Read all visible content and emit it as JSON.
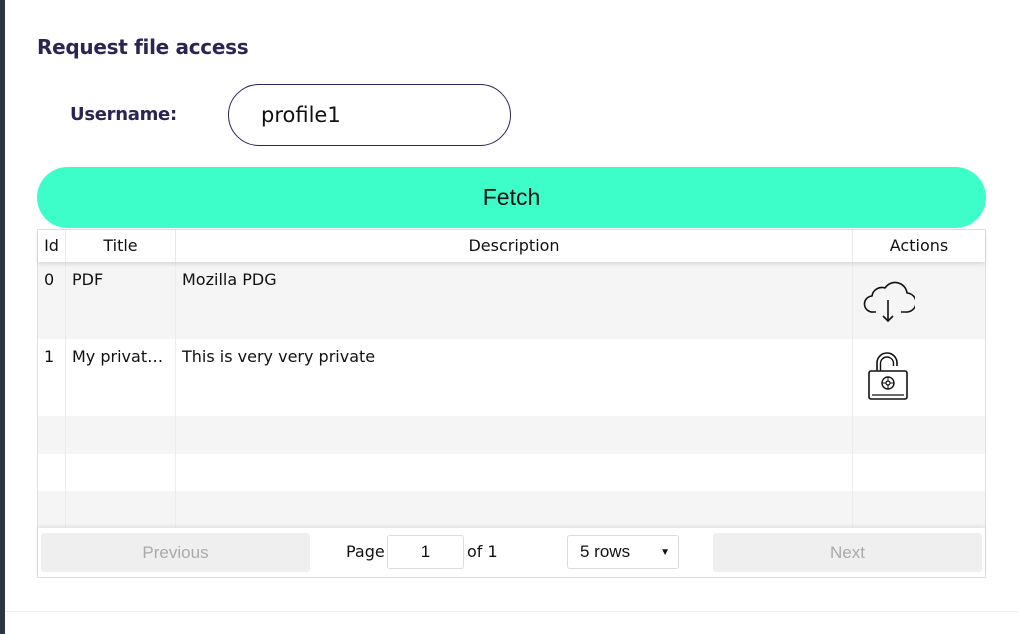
{
  "page": {
    "title": "Request file access"
  },
  "form": {
    "username_label": "Username:",
    "username_value": "profile1",
    "fetch_label": "Fetch"
  },
  "table": {
    "headers": {
      "id": "Id",
      "title": "Title",
      "description": "Description",
      "actions": "Actions"
    },
    "rows": [
      {
        "id": "0",
        "title": "PDF",
        "description": "Mozilla PDG",
        "action_icon": "cloud-download-icon"
      },
      {
        "id": "1",
        "title": "My private...",
        "description": "This is very very private",
        "action_icon": "unlock-padlock-icon"
      }
    ]
  },
  "pagination": {
    "previous_label": "Previous",
    "page_label": "Page",
    "current_page": "1",
    "of_label": "of 1",
    "rows_option": "5 rows",
    "next_label": "Next"
  },
  "colors": {
    "accent": "#3dfdc8",
    "heading": "#2c2554",
    "sidebar": "#2e3440"
  }
}
